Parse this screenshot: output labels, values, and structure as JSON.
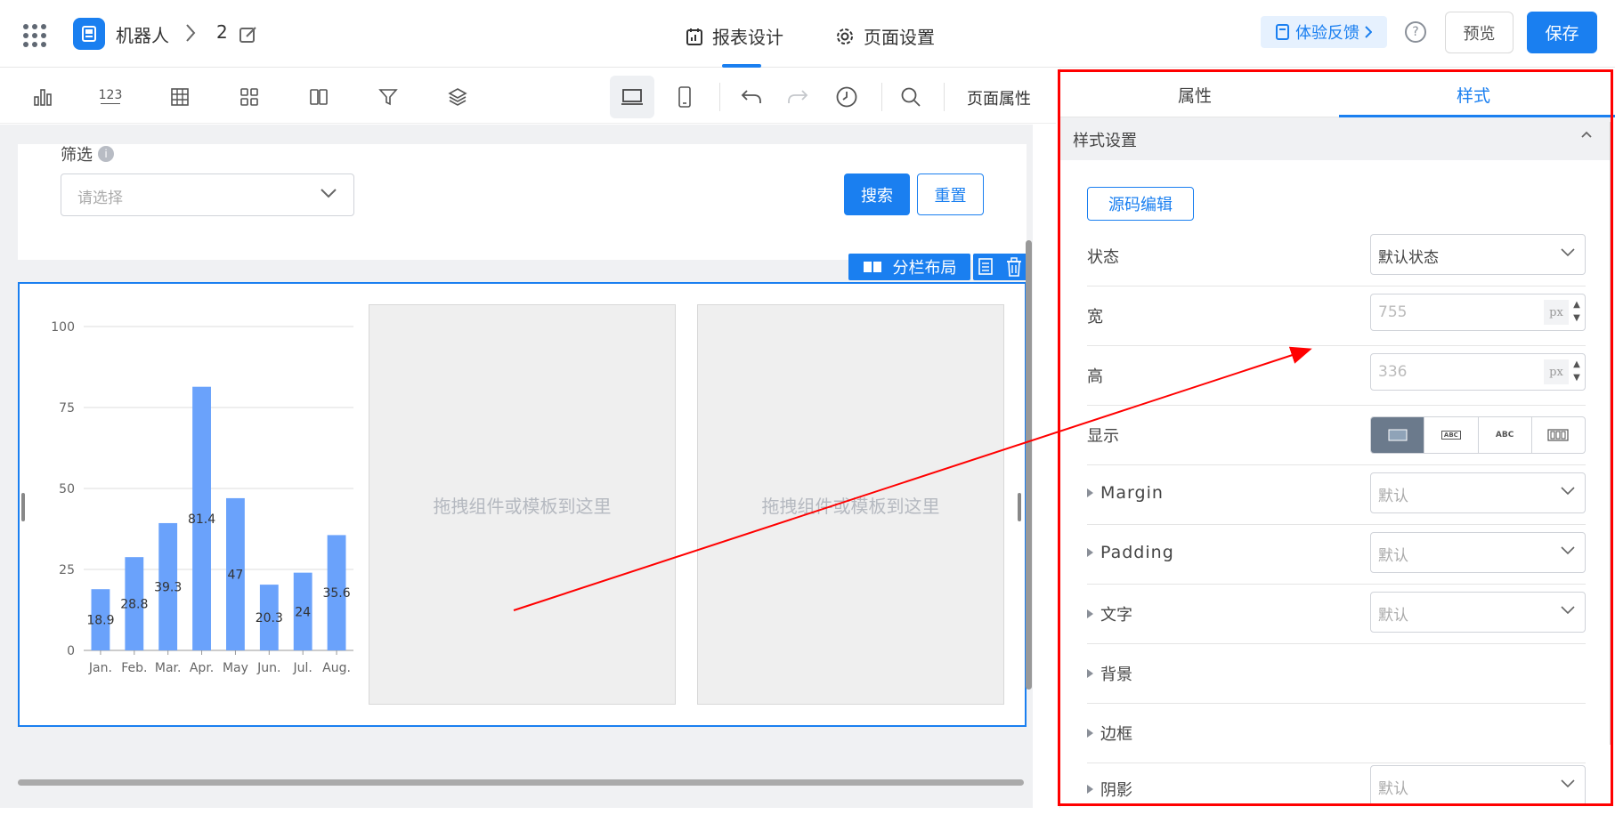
{
  "header": {
    "app_name": "机器人",
    "crumb_number": "2",
    "tabs": [
      {
        "label": "报表设计",
        "active": true
      },
      {
        "label": "页面设置",
        "active": false
      }
    ],
    "feedback_label": "体验反馈",
    "help_symbol": "?",
    "preview_label": "预览",
    "save_label": "保存"
  },
  "toolbar": {
    "icons": [
      "bar-chart-icon",
      "number-icon",
      "table-icon",
      "widgets-icon",
      "columns-icon",
      "filter-icon",
      "layers-icon",
      "desktop-icon",
      "mobile-icon",
      "undo-icon",
      "redo-icon",
      "history-icon",
      "search-icon"
    ],
    "number_glyph": "123",
    "page_props_label": "页面属性"
  },
  "filter": {
    "label": "筛选",
    "info_glyph": "i",
    "placeholder": "请选择",
    "search_label": "搜索",
    "reset_label": "重置"
  },
  "layout": {
    "tag_label": "分栏布局",
    "drop_hint_1": "拖拽组件或模板到这里",
    "drop_hint_2": "拖拽组件或模板到这里"
  },
  "chart_data": {
    "type": "bar",
    "categories": [
      "Jan.",
      "Feb.",
      "Mar.",
      "Apr.",
      "May",
      "Jun.",
      "Jul.",
      "Aug."
    ],
    "values": [
      18.9,
      28.8,
      39.3,
      81.4,
      47,
      20.3,
      24,
      35.6
    ],
    "ylim": [
      0,
      100
    ],
    "yticks": [
      0,
      25,
      50,
      75,
      100
    ],
    "grid": true,
    "bar_color": "#6aa2fb"
  },
  "panel": {
    "tabs": [
      {
        "label": "属性",
        "active": false
      },
      {
        "label": "样式",
        "active": true
      }
    ],
    "section_title": "样式设置",
    "source_edit_label": "源码编辑",
    "rows": {
      "state_label": "状态",
      "state_value": "默认状态",
      "width_label": "宽",
      "width_placeholder": "755",
      "width_unit": "px",
      "height_label": "高",
      "height_placeholder": "336",
      "height_unit": "px",
      "display_label": "显示",
      "display_options": [
        "block",
        "inline-block",
        "inline",
        "flex"
      ],
      "display_selected": "block",
      "display_glyph_small": "ABC",
      "display_glyph_inline": "ABC",
      "margin_label": "Margin",
      "margin_value": "默认",
      "padding_label": "Padding",
      "padding_value": "默认",
      "text_label": "文字",
      "text_value": "默认",
      "background_label": "背景",
      "border_label": "边框",
      "shadow_label": "阴影",
      "shadow_value": "默认"
    }
  },
  "colors": {
    "accent": "#1a7ff0",
    "annotation": "#ff0000"
  }
}
